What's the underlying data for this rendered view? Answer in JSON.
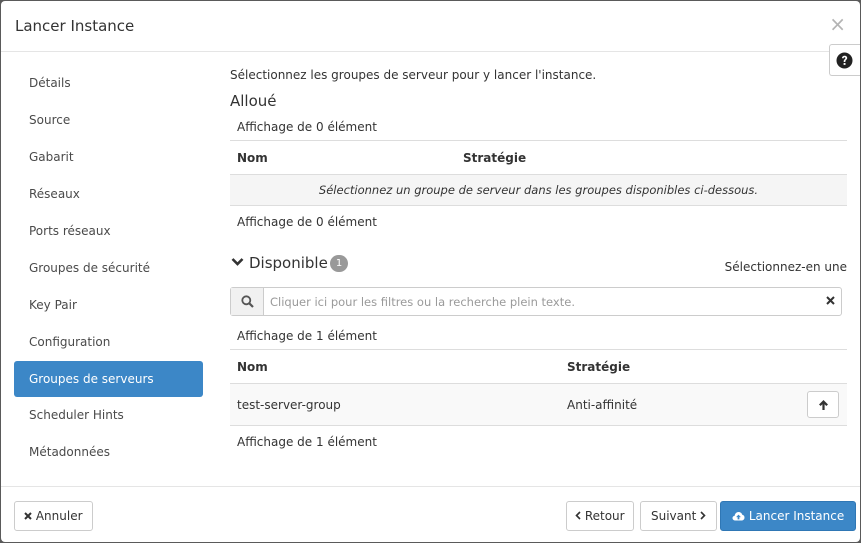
{
  "modal": {
    "title": "Lancer Instance",
    "close_glyph": "×"
  },
  "nav": {
    "items": [
      {
        "label": "Détails"
      },
      {
        "label": "Source"
      },
      {
        "label": "Gabarit"
      },
      {
        "label": "Réseaux"
      },
      {
        "label": "Ports réseaux"
      },
      {
        "label": "Groupes de sécurité"
      },
      {
        "label": "Key Pair"
      },
      {
        "label": "Configuration"
      },
      {
        "label": "Groupes de serveurs",
        "active": true
      },
      {
        "label": "Scheduler Hints"
      },
      {
        "label": "Métadonnées"
      }
    ]
  },
  "content": {
    "lead": "Sélectionnez les groupes de serveur pour y lancer l'instance.",
    "allocated": {
      "title": "Alloué",
      "count_top": "Affichage de 0 élément",
      "col_name": "Nom",
      "col_strategy": "Stratégie",
      "empty_message": "Sélectionnez un groupe de serveur dans les groupes disponibles ci-dessous.",
      "count_bottom": "Affichage de 0 élément"
    },
    "available": {
      "title": "Disponible",
      "badge": "1",
      "pick_one": "Sélectionnez-en une",
      "search_placeholder": "Cliquer ici pour les filtres ou la recherche plein texte.",
      "count_top": "Affichage de 1 élément",
      "col_name": "Nom",
      "col_strategy": "Stratégie",
      "rows": [
        {
          "name": "test-server-group",
          "strategy": "Anti-affinité"
        }
      ],
      "count_bottom": "Affichage de 1 élément"
    }
  },
  "footer": {
    "cancel": "Annuler",
    "back": "Retour",
    "next": "Suivant",
    "launch": "Lancer Instance"
  },
  "colors": {
    "primary": "#3c87c7",
    "border": "#dddddd",
    "badge": "#999999"
  },
  "icons": {
    "close": "close-x-icon",
    "help": "question-circle-icon",
    "chevron": "chevron-down-icon",
    "search": "search-icon",
    "clear": "times-icon",
    "up": "arrow-up-icon",
    "back": "chevron-left-icon",
    "next": "chevron-right-icon",
    "launch": "cloud-upload-icon"
  }
}
